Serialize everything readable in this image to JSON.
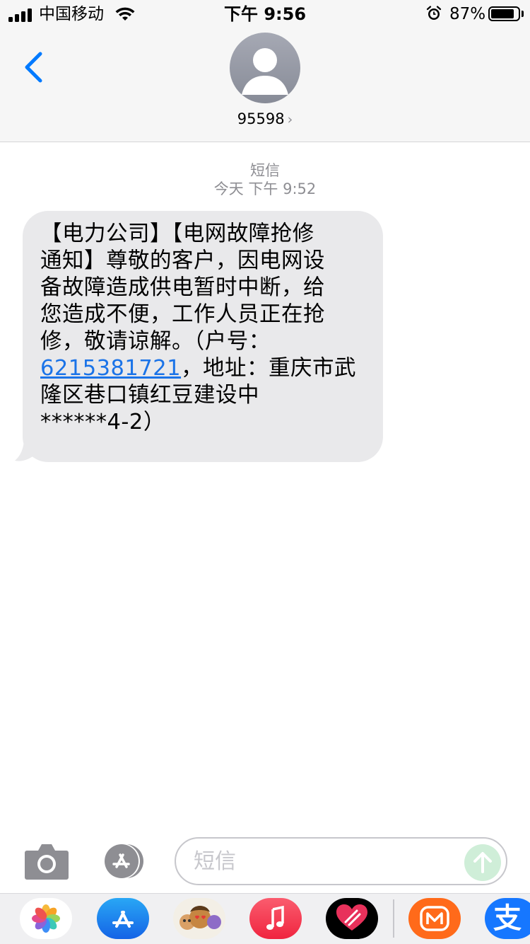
{
  "status_bar": {
    "carrier": "中国移动",
    "time": "下午 9:56",
    "battery_percent": "87%",
    "battery_level": 0.87
  },
  "header": {
    "contact": "95598",
    "back_icon": "chevron-left-icon",
    "avatar_icon": "person-silhouette-icon"
  },
  "conversation": {
    "service_label": "短信",
    "timestamp": "今天 下午 9:52"
  },
  "message": {
    "lines": [
      "【电力公司】【电网故障抢修",
      "通知】尊敬的客户，因电网设",
      "备故障造成供电暂时中断，给",
      "您造成不便，工作人员正在抢",
      "修，敬请谅解。（户号："
    ],
    "account_number": "6215381721",
    "after_account": "，地址：重庆市武",
    "line7": "隆区巷口镇红豆建设中",
    "line8": "******4-2）"
  },
  "input": {
    "placeholder": "短信"
  },
  "app_strip": [
    {
      "name": "Photos",
      "icon": "photos-icon"
    },
    {
      "name": "App Store",
      "icon": "app-store-icon"
    },
    {
      "name": "Memoji",
      "icon": "memoji-icon"
    },
    {
      "name": "Music",
      "icon": "music-icon"
    },
    {
      "name": "Digital Touch",
      "icon": "heart-touch-icon"
    },
    {
      "name": "Mango TV",
      "icon": "mango-tv-icon"
    },
    {
      "name": "Alipay",
      "icon": "alipay-icon",
      "glyph": "支"
    }
  ],
  "colors": {
    "link": "#1a73e8",
    "ios_blue": "#007aff",
    "bubble": "#e9e9eb",
    "header_bg": "#f6f6f6"
  }
}
